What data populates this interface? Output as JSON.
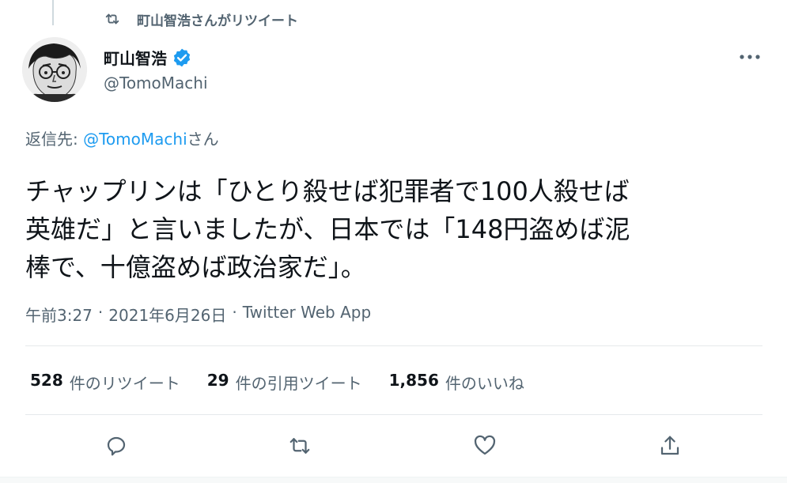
{
  "retweet_context": {
    "label": "町山智浩さんがリツイート",
    "icon": "retweet-icon"
  },
  "author": {
    "name": "町山智浩",
    "handle": "@TomoMachi",
    "verified_icon": "verified-badge-icon",
    "avatar": "avatar-illustration"
  },
  "reply_to": {
    "prefix": "返信先: ",
    "mention": "@TomoMachi",
    "suffix": "さん"
  },
  "tweet": {
    "text": "チャップリンは「ひとり殺せば犯罪者で100人殺せば\n英雄だ」と言いましたが、日本では「148円盗めば泥\n棒で、十億盗めば政治家だ」。"
  },
  "meta": {
    "time": "午前3:27",
    "separator1": "·",
    "date": "2021年6月26日",
    "separator2": "·",
    "source": "Twitter Web App"
  },
  "stats": {
    "retweets": {
      "count": "528",
      "label": "件のリツイート"
    },
    "quotes": {
      "count": "29",
      "label": "件の引用ツイート"
    },
    "likes": {
      "count": "1,856",
      "label": "件のいいね"
    }
  },
  "actions": [
    "reply-icon",
    "retweet-icon",
    "like-icon",
    "share-icon"
  ],
  "colors": {
    "accent": "#1d9bf0",
    "text_primary": "#0f1419",
    "text_secondary": "#536471",
    "divider": "#e5e9eb"
  }
}
